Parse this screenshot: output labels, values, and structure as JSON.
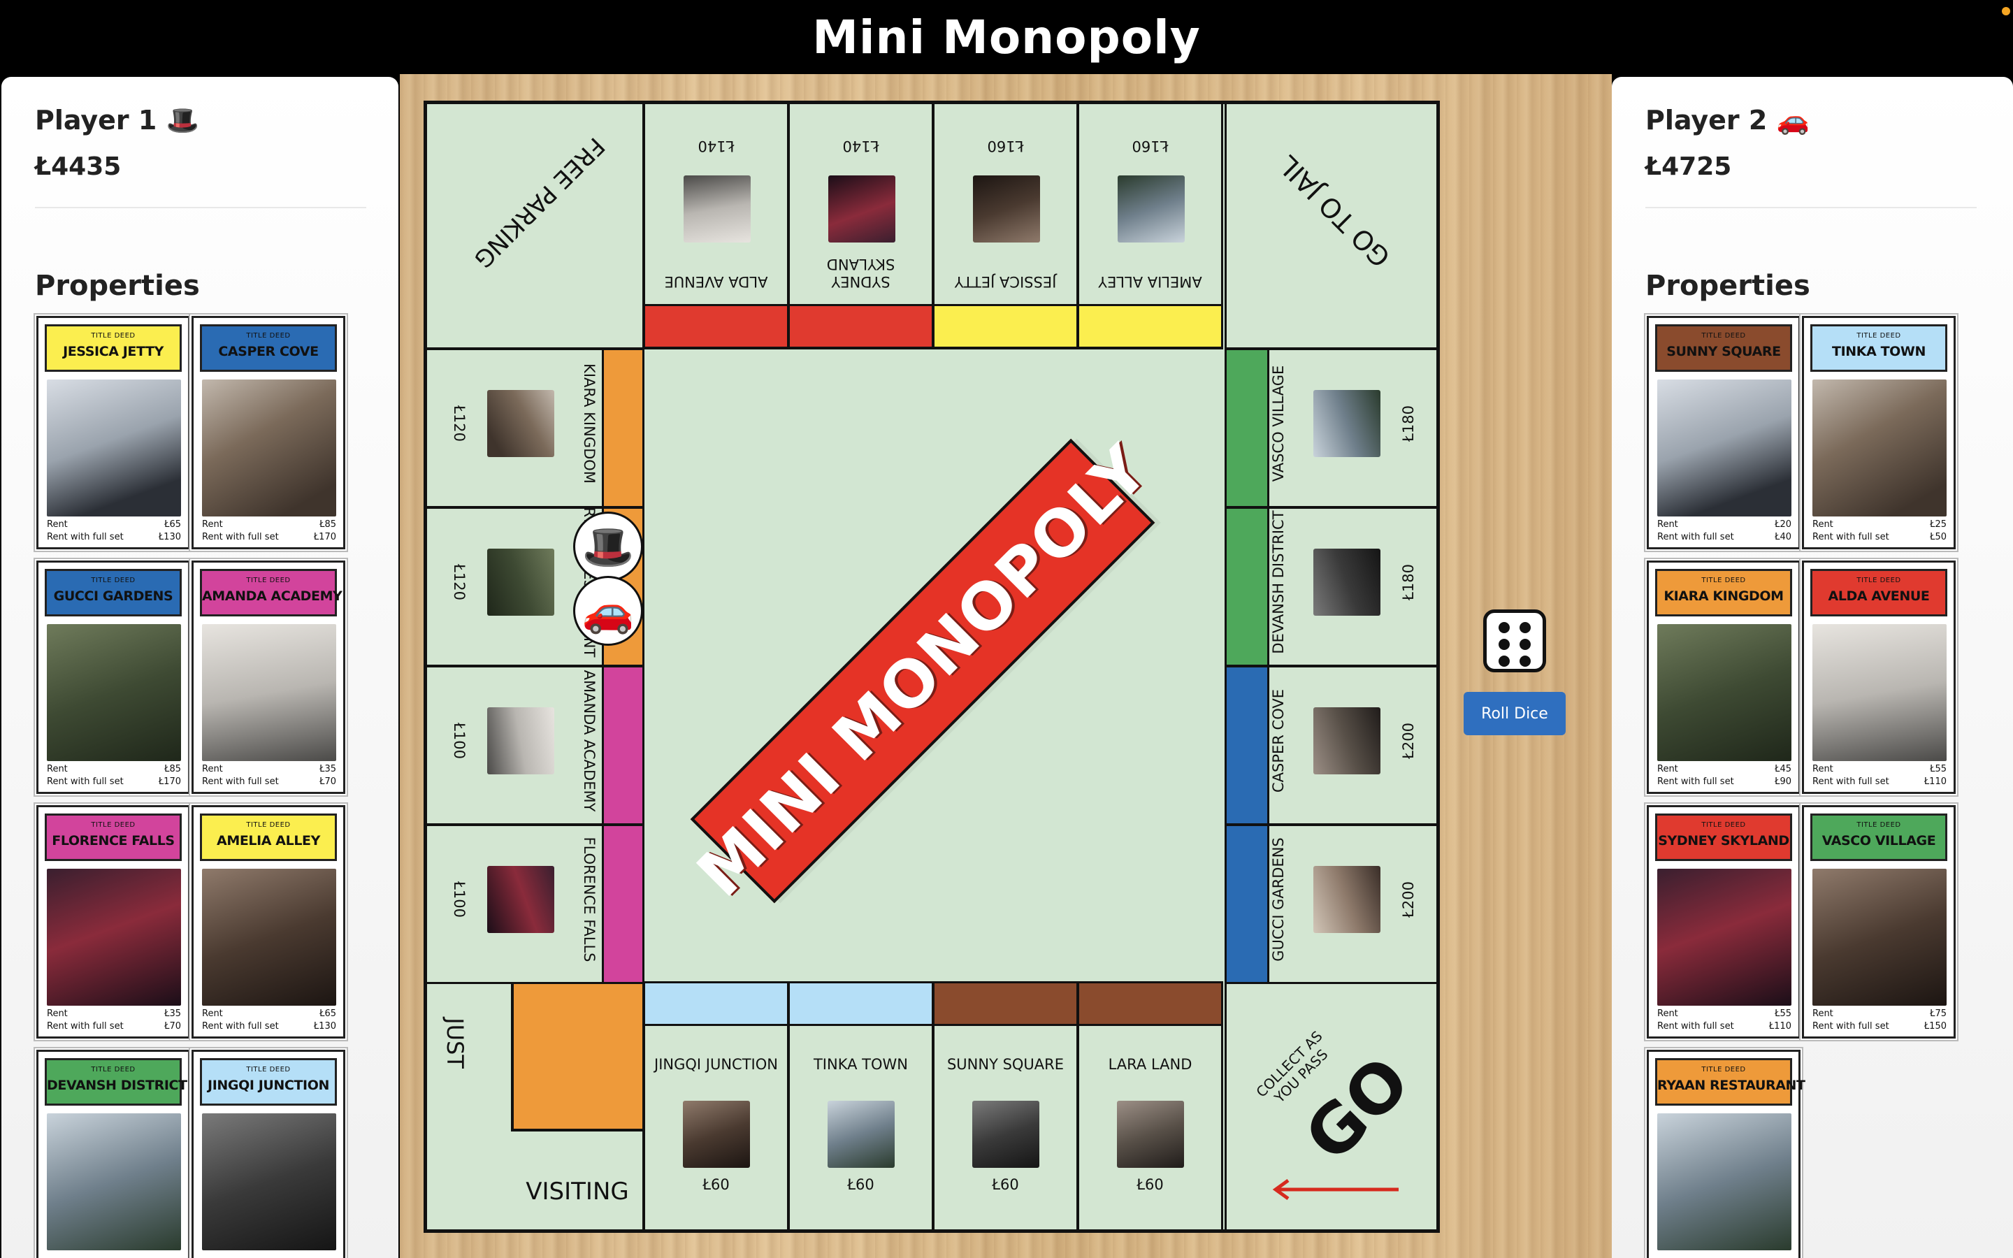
{
  "header": {
    "title": "Mini Monopoly"
  },
  "colors": {
    "red": "#e03a2f",
    "yellow": "#fbee4f",
    "orange": "#ee9a3a",
    "magenta": "#d2449c",
    "green": "#4ea85b",
    "blue": "#2a6bb3",
    "lightblue": "#b5dff7",
    "brown": "#8a4b2d",
    "board": "#d3e6d2",
    "button": "#2f6fbf"
  },
  "player1": {
    "name": "Player 1",
    "icon": "🎩",
    "money": "Ł4435",
    "properties_heading": "Properties",
    "deeds": [
      {
        "label": "TITLE DEED",
        "name": "JESSICA JETTY",
        "color": "#fbee4f",
        "rent_label": "Rent",
        "rent": "Ł65",
        "full_label": "Rent with full set",
        "full": "Ł130"
      },
      {
        "label": "TITLE DEED",
        "name": "CASPER COVE",
        "color": "#2a6bb3",
        "rent_label": "Rent",
        "rent": "Ł85",
        "full_label": "Rent with full set",
        "full": "Ł170"
      },
      {
        "label": "TITLE DEED",
        "name": "GUCCI GARDENS",
        "color": "#2a6bb3",
        "rent_label": "Rent",
        "rent": "Ł85",
        "full_label": "Rent with full set",
        "full": "Ł170"
      },
      {
        "label": "TITLE DEED",
        "name": "AMANDA ACADEMY",
        "color": "#d2449c",
        "rent_label": "Rent",
        "rent": "Ł35",
        "full_label": "Rent with full set",
        "full": "Ł70"
      },
      {
        "label": "TITLE DEED",
        "name": "FLORENCE FALLS",
        "color": "#d2449c",
        "rent_label": "Rent",
        "rent": "Ł35",
        "full_label": "Rent with full set",
        "full": "Ł70"
      },
      {
        "label": "TITLE DEED",
        "name": "AMELIA ALLEY",
        "color": "#fbee4f",
        "rent_label": "Rent",
        "rent": "Ł65",
        "full_label": "Rent with full set",
        "full": "Ł130"
      },
      {
        "label": "TITLE DEED",
        "name": "DEVANSH DISTRICT",
        "color": "#4ea85b"
      },
      {
        "label": "TITLE DEED",
        "name": "JINGQI JUNCTION",
        "color": "#b5dff7"
      }
    ]
  },
  "player2": {
    "name": "Player 2",
    "icon": "🚗",
    "money": "Ł4725",
    "properties_heading": "Properties",
    "deeds": [
      {
        "label": "TITLE DEED",
        "name": "SUNNY SQUARE",
        "color": "#8a4b2d",
        "rent_label": "Rent",
        "rent": "Ł20",
        "full_label": "Rent with full set",
        "full": "Ł40"
      },
      {
        "label": "TITLE DEED",
        "name": "TINKA TOWN",
        "color": "#b5dff7",
        "rent_label": "Rent",
        "rent": "Ł25",
        "full_label": "Rent with full set",
        "full": "Ł50"
      },
      {
        "label": "TITLE DEED",
        "name": "KIARA KINGDOM",
        "color": "#ee9a3a",
        "rent_label": "Rent",
        "rent": "Ł45",
        "full_label": "Rent with full set",
        "full": "Ł90"
      },
      {
        "label": "TITLE DEED",
        "name": "ALDA AVENUE",
        "color": "#e03a2f",
        "rent_label": "Rent",
        "rent": "Ł55",
        "full_label": "Rent with full set",
        "full": "Ł110"
      },
      {
        "label": "TITLE DEED",
        "name": "SYDNEY SKYLAND",
        "color": "#e03a2f",
        "rent_label": "Rent",
        "rent": "Ł55",
        "full_label": "Rent with full set",
        "full": "Ł110"
      },
      {
        "label": "TITLE DEED",
        "name": "VASCO VILLAGE",
        "color": "#4ea85b",
        "rent_label": "Rent",
        "rent": "Ł75",
        "full_label": "Rent with full set",
        "full": "Ł150"
      },
      {
        "label": "TITLE DEED",
        "name": "RYAAN RESTAURANT",
        "color": "#ee9a3a"
      }
    ]
  },
  "board": {
    "logo": "MINI MONOPOLY",
    "corners": {
      "free_parking": "FREE PARKING",
      "go_to_jail": "GO TO JAIL",
      "just": "JUST",
      "visiting": "VISITING",
      "collect": "COLLECT AS YOU PASS",
      "go": "GO"
    },
    "top": [
      {
        "name": "ALDA AVENUE",
        "price": "Ł140"
      },
      {
        "name": "SYDNEY SKYLAND",
        "price": "Ł140"
      },
      {
        "name": "JESSICA JETTY",
        "price": "Ł160"
      },
      {
        "name": "AMELIA ALLEY",
        "price": "Ł160"
      }
    ],
    "bottom": [
      {
        "name": "JINGQI JUNCTION",
        "price": "Ł60"
      },
      {
        "name": "TINKA TOWN",
        "price": "Ł60"
      },
      {
        "name": "SUNNY SQUARE",
        "price": "Ł60"
      },
      {
        "name": "LARA LAND",
        "price": "Ł60"
      }
    ],
    "left": [
      {
        "name": "KIARA KINGDOM",
        "price": "Ł120"
      },
      {
        "name": "RYAAN RESTAURANT",
        "price": "Ł120"
      },
      {
        "name": "AMANDA ACADEMY",
        "price": "Ł100"
      },
      {
        "name": "FLORENCE FALLS",
        "price": "Ł100"
      }
    ],
    "right": [
      {
        "name": "VASCO VILLAGE",
        "price": "Ł180"
      },
      {
        "name": "DEVANSH DISTRICT",
        "price": "Ł180"
      },
      {
        "name": "CASPER COVE",
        "price": "Ł200"
      },
      {
        "name": "GUCCI GARDENS",
        "price": "Ł200"
      }
    ]
  },
  "tokens": {
    "player1": "🎩",
    "player2": "🚗"
  },
  "dice": {
    "value": 6
  },
  "roll_button": "Roll Dice"
}
